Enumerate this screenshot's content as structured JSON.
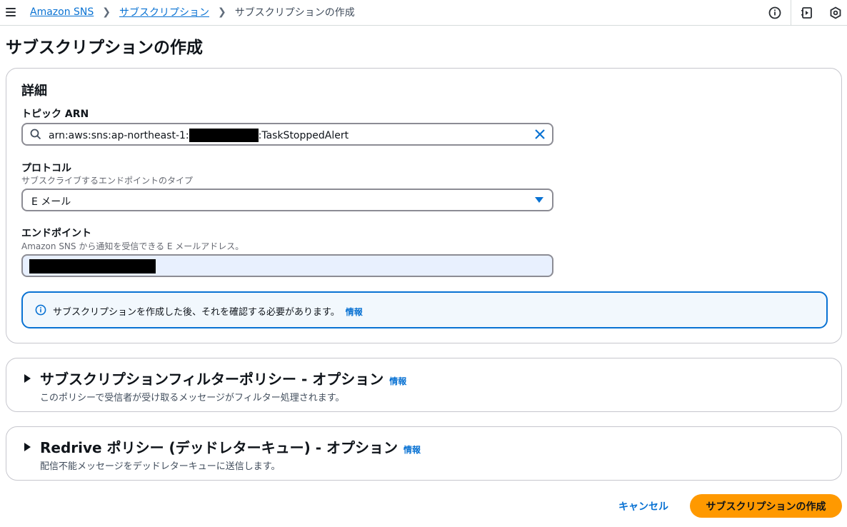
{
  "breadcrumb": {
    "home": "Amazon SNS",
    "parent": "サブスクリプション",
    "current": "サブスクリプションの作成",
    "separator": "❯"
  },
  "page": {
    "title": "サブスクリプションの作成"
  },
  "details": {
    "title": "詳細",
    "topic_arn": {
      "label": "トピック ARN",
      "value_prefix": "arn:aws:sns:ap-northeast-1:",
      "value_suffix": ":TaskStoppedAlert"
    },
    "protocol": {
      "label": "プロトコル",
      "description": "サブスクライブするエンドポイントのタイプ",
      "selected": "E メール"
    },
    "endpoint": {
      "label": "エンドポイント",
      "description": "Amazon SNS から通知を受信できる E メールアドレス。"
    },
    "alert": {
      "text": "サブスクリプションを作成した後、それを確認する必要があります。",
      "link": "情報"
    }
  },
  "filter_policy": {
    "title": "サブスクリプションフィルターポリシー - オプション",
    "info": "情報",
    "description": "このポリシーで受信者が受け取るメッセージがフィルター処理されます。"
  },
  "redrive_policy": {
    "title": "Redrive ポリシー (デッドレターキュー) - オプション",
    "info": "情報",
    "description": "配信不能メッセージをデッドレターキューに送信します。"
  },
  "actions": {
    "cancel": "キャンセル",
    "submit": "サブスクリプションの作成"
  },
  "colors": {
    "accent": "#0972d3",
    "primary_button": "#ff9900",
    "endpoint_fill": "#e8f0fe"
  },
  "icons": [
    "menu-icon",
    "info-icon",
    "notes-icon",
    "settings-hex-icon",
    "search-icon",
    "close-icon"
  ]
}
